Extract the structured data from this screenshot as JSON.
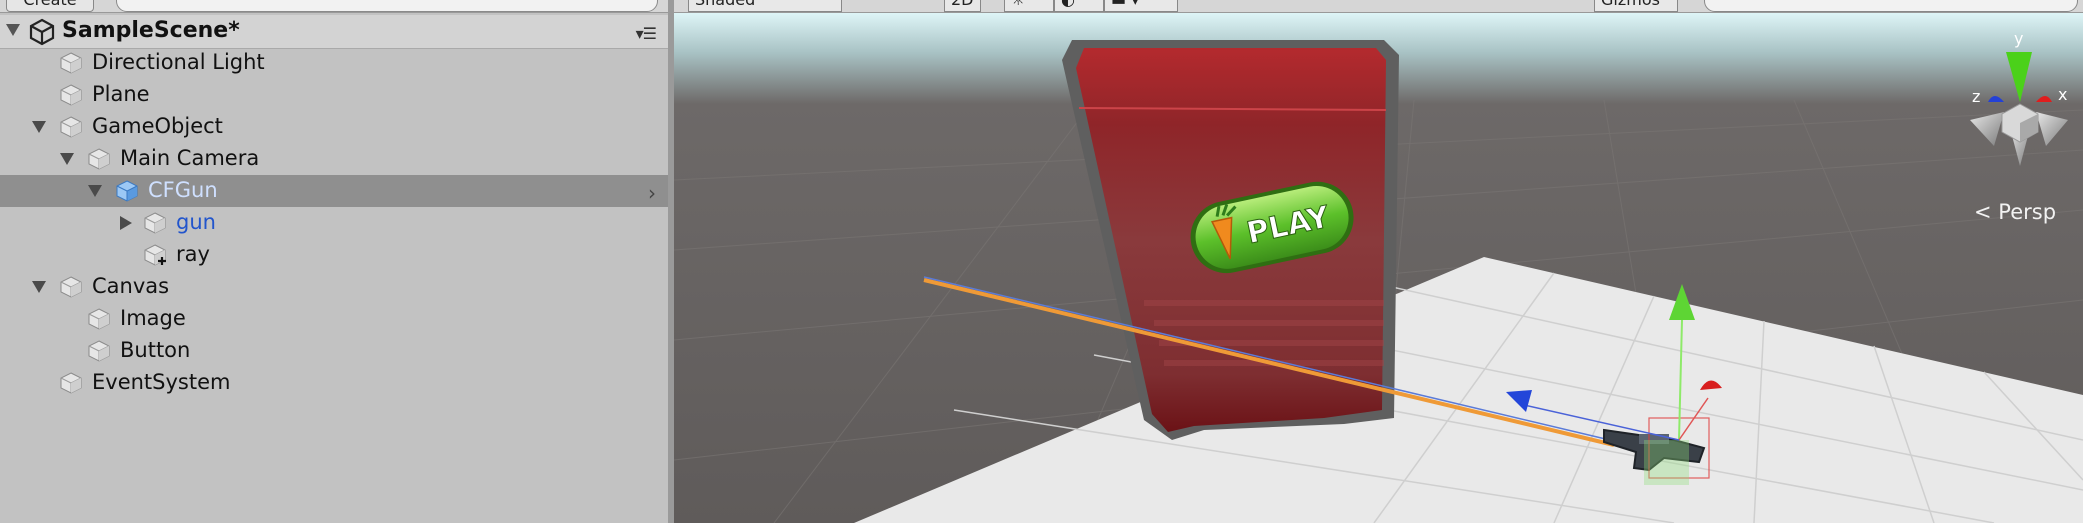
{
  "hierarchy": {
    "create_label": "Create",
    "scene_title": "SampleScene*",
    "items": [
      {
        "label": "Directional Light"
      },
      {
        "label": "Plane"
      },
      {
        "label": "GameObject"
      },
      {
        "label": "Main Camera"
      },
      {
        "label": "CFGun"
      },
      {
        "label": "gun"
      },
      {
        "label": "ray"
      },
      {
        "label": "Canvas"
      },
      {
        "label": "Image"
      },
      {
        "label": "Button"
      },
      {
        "label": "EventSystem"
      }
    ]
  },
  "scene": {
    "shading_label": "Shaded",
    "mode_2d_label": "2D",
    "gizmos_label": "Gizmos",
    "play_button_label": "PLAY",
    "persp_label": "Persp",
    "axis_labels": {
      "x": "x",
      "y": "y",
      "z": "z"
    }
  },
  "colors": {
    "selection": "#8f8f8f",
    "panel_bg": "#c2c2c2",
    "prefab_blue": "#2255cc",
    "play_green": "#5cc02a",
    "panel_red": "#8b1a1f"
  }
}
